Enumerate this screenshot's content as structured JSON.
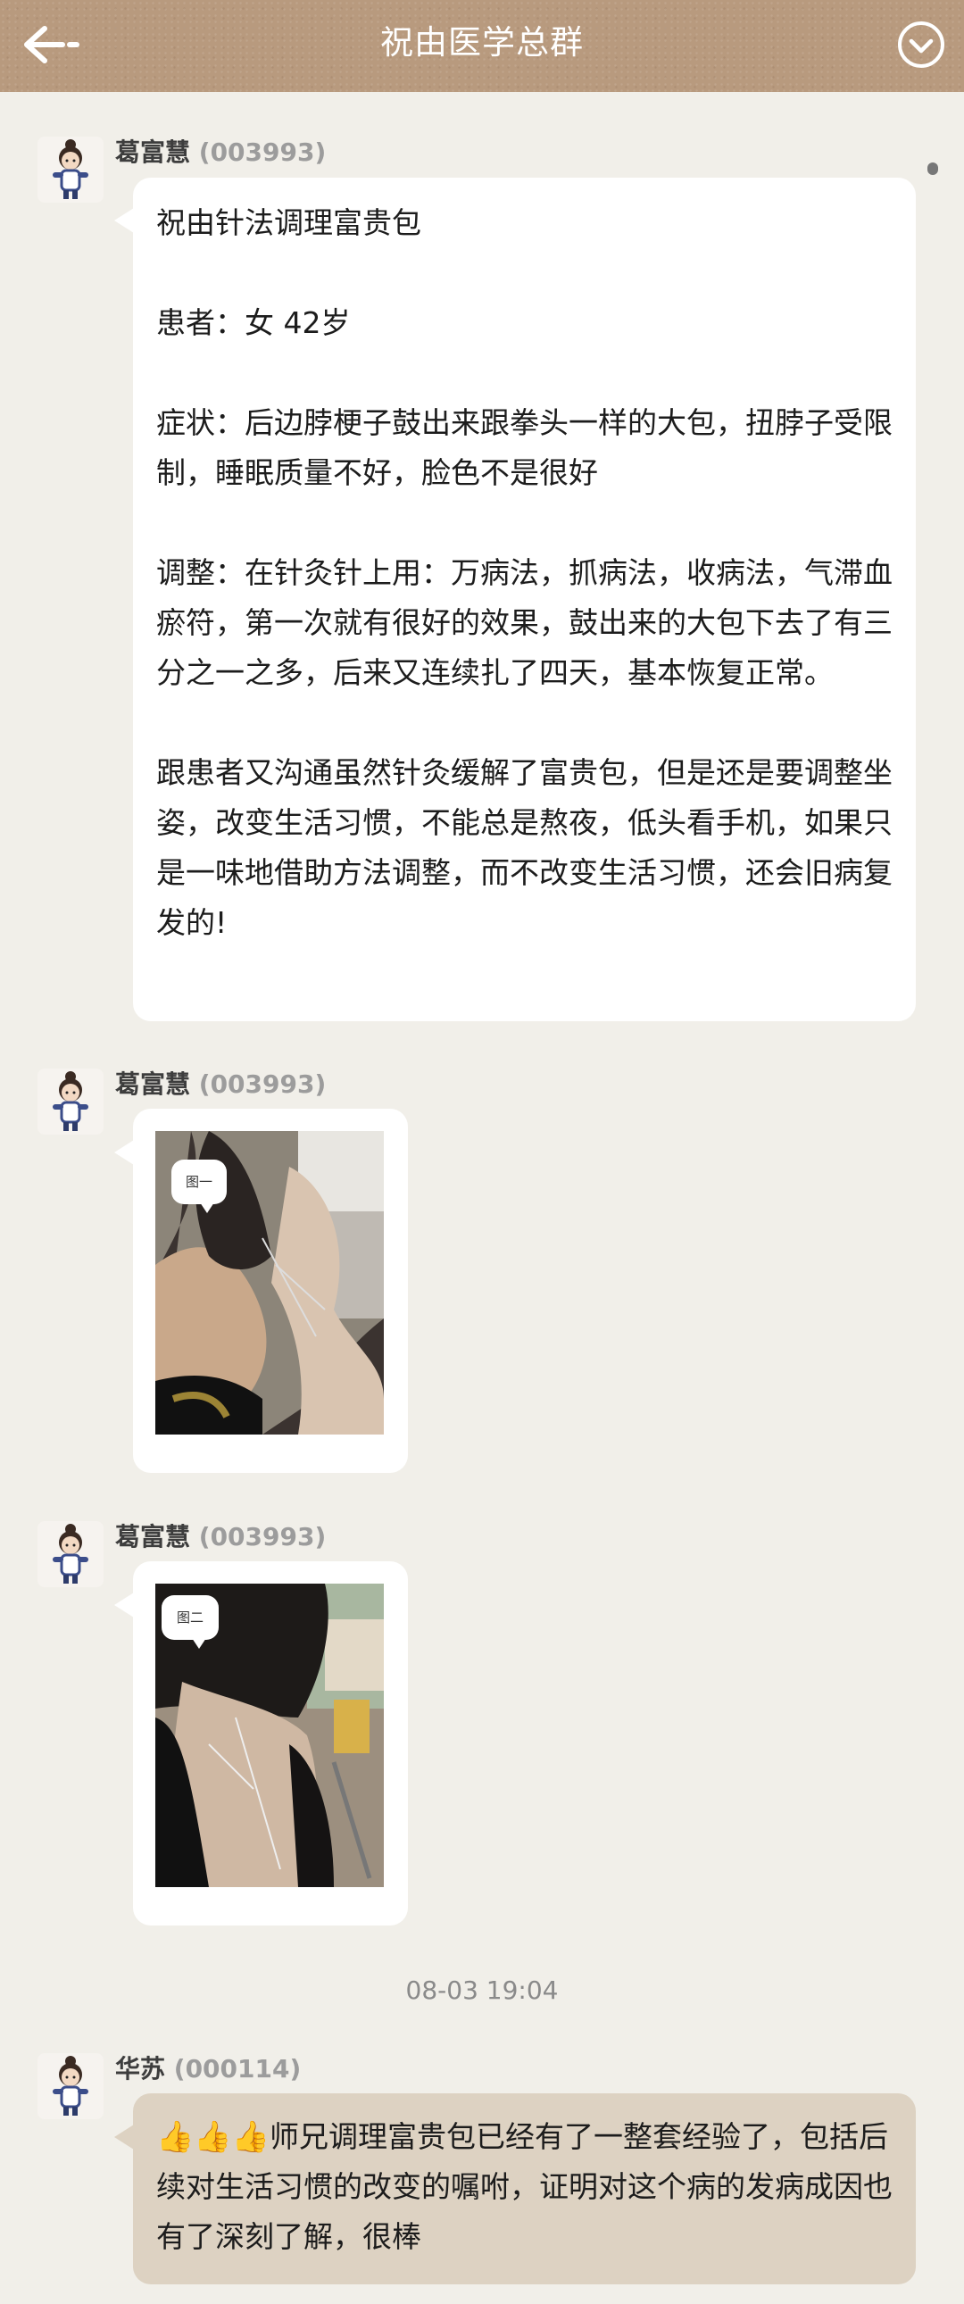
{
  "header": {
    "title": "祝由医学总群",
    "back_icon": "back-arrow-icon",
    "menu_icon": "chevron-down-circle-icon",
    "background_color": "#b89a7e"
  },
  "messages": [
    {
      "sender_name": "葛富慧",
      "sender_id": "(003993)",
      "type": "text",
      "text": "祝由针法调理富贵包\n\n患者：女 42岁\n\n症状：后边脖梗子鼓出来跟拳头一样的大包，扭脖子受限制，睡眠质量不好，脸色不是很好\n\n调整：在针灸针上用：万病法，抓病法，收病法，气滞血瘀符，第一次就有很好的效果，鼓出来的大包下去了有三分之一之多，后来又连续扎了四天，基本恢复正常。\n\n跟患者又沟通虽然针灸缓解了富贵包，但是还是要调整坐姿，改变生活习惯，不能总是熬夜，低头看手机，如果只是一味地借助方法调整，而不改变生活习惯，还会旧病复发的!"
    },
    {
      "sender_name": "葛富慧",
      "sender_id": "(003993)",
      "type": "image",
      "image_label": "图一"
    },
    {
      "sender_name": "葛富慧",
      "sender_id": "(003993)",
      "type": "image",
      "image_label": "图二"
    }
  ],
  "timestamp": "08-03 19:04",
  "reply": {
    "sender_name": "华苏",
    "sender_id": "(000114)",
    "emoji": "👍👍👍",
    "text": "师兄调理富贵包已经有了一整套经验了，包括后续对生活习惯的改变的嘱咐，证明对这个病的发病成因也有了深刻了解，很棒",
    "bubble_color": "#ddd2c2"
  }
}
